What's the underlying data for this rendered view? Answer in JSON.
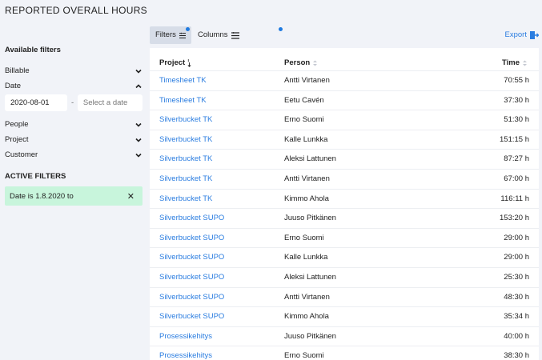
{
  "page_title": "REPORTED OVERALL HOURS",
  "toolbar": {
    "filters_label": "Filters",
    "columns_label": "Columns",
    "export_label": "Export",
    "accent": "#1f7ae0"
  },
  "sidebar": {
    "available_heading": "Available filters",
    "filters": [
      {
        "label": "Billable",
        "state": "collapsed"
      },
      {
        "label": "Date",
        "state": "expanded"
      },
      {
        "label": "People",
        "state": "collapsed"
      },
      {
        "label": "Project",
        "state": "collapsed"
      },
      {
        "label": "Customer",
        "state": "collapsed"
      }
    ],
    "date_from_value": "2020-08-01",
    "date_separator": "-",
    "date_to_placeholder": "Select a date",
    "active_heading": "ACTIVE FILTERS",
    "active_filter_label": "Date is 1.8.2020 to",
    "active_chip_color": "#c8f5dc"
  },
  "table": {
    "columns": {
      "project": "Project",
      "person": "Person",
      "time": "Time"
    },
    "rows": [
      {
        "project": "Timesheet TK",
        "person": "Antti Virtanen",
        "time": "70:55 h"
      },
      {
        "project": "Timesheet TK",
        "person": "Eetu Cavén",
        "time": "37:30 h"
      },
      {
        "project": "Silverbucket TK",
        "person": "Erno Suomi",
        "time": "51:30 h"
      },
      {
        "project": "Silverbucket TK",
        "person": "Kalle Lunkka",
        "time": "151:15 h"
      },
      {
        "project": "Silverbucket TK",
        "person": "Aleksi Lattunen",
        "time": "87:27 h"
      },
      {
        "project": "Silverbucket TK",
        "person": "Antti Virtanen",
        "time": "67:00 h"
      },
      {
        "project": "Silverbucket TK",
        "person": "Kimmo Ahola",
        "time": "116:11 h"
      },
      {
        "project": "Silverbucket SUPO",
        "person": "Juuso Pitkänen",
        "time": "153:20 h"
      },
      {
        "project": "Silverbucket SUPO",
        "person": "Erno Suomi",
        "time": "29:00 h"
      },
      {
        "project": "Silverbucket SUPO",
        "person": "Kalle Lunkka",
        "time": "29:00 h"
      },
      {
        "project": "Silverbucket SUPO",
        "person": "Aleksi Lattunen",
        "time": "25:30 h"
      },
      {
        "project": "Silverbucket SUPO",
        "person": "Antti Virtanen",
        "time": "48:30 h"
      },
      {
        "project": "Silverbucket SUPO",
        "person": "Kimmo Ahola",
        "time": "35:34 h"
      },
      {
        "project": "Prosessikehitys",
        "person": "Juuso Pitkänen",
        "time": "40:00 h"
      },
      {
        "project": "Prosessikehitys",
        "person": "Erno Suomi",
        "time": "38:30 h"
      }
    ]
  }
}
